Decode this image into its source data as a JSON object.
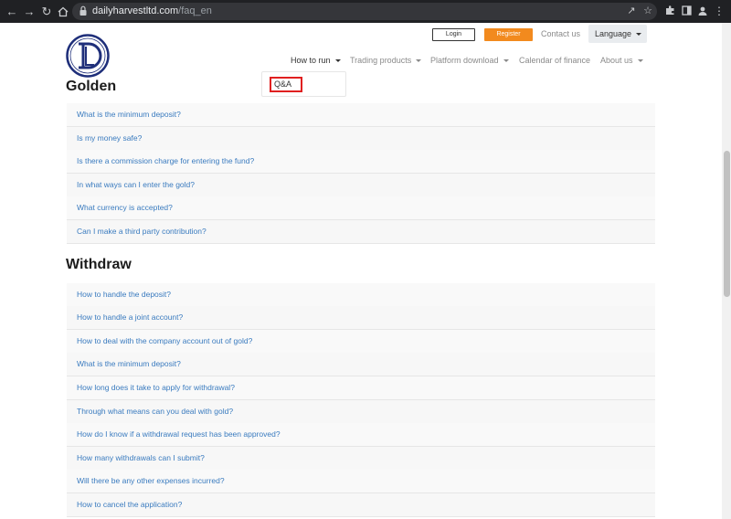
{
  "browser": {
    "url_host": "dailyharvestltd.com",
    "url_path": "/faq_en",
    "icons": {
      "back": "arrow-left-icon",
      "forward": "arrow-right-icon",
      "reload": "reload-icon",
      "home": "home-icon",
      "lock": "lock-icon",
      "share": "share-icon",
      "bookmark": "star-icon",
      "extensions": "puzzle-icon",
      "sidepanel": "sidepanel-icon",
      "profile": "profile-icon",
      "menu": "kebab-menu-icon"
    }
  },
  "header": {
    "brand": "Golden",
    "login_label": "Login",
    "register_label": "Register",
    "contact_label": "Contact us",
    "language_label": "Language",
    "colors": {
      "register": "#f28a1e",
      "link": "#3a7bbf",
      "highlight": "#e02020"
    }
  },
  "nav": {
    "items": [
      {
        "label": "How to run"
      },
      {
        "label": "Trading products"
      },
      {
        "label": "Platform download"
      },
      {
        "label": "Calendar of finance"
      },
      {
        "label": "About us"
      }
    ],
    "dropdown": {
      "item": "Q&A"
    }
  },
  "deposit_faq": [
    "What is the minimum deposit?",
    "Is my money safe?",
    "Is there a commission charge for entering the fund?",
    "In what ways can I enter the gold?",
    "What currency is accepted?",
    "Can I make a third party contribution?"
  ],
  "withdraw": {
    "title": "Withdraw",
    "items": [
      "How to handle the deposit?",
      "How to handle a joint account?",
      "How to deal with the company account out of gold?",
      "What is the minimum deposit?",
      "How long does it take to apply for withdrawal?",
      "Through what means can you deal with gold?",
      "How do I know if a withdrawal request has been approved?",
      "How many withdrawals can I submit?",
      "Will there be any other expenses incurred?",
      "How to cancel the application?"
    ]
  }
}
